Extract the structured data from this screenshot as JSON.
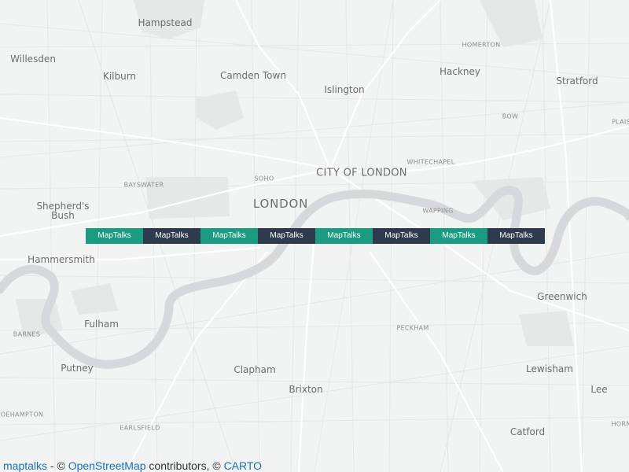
{
  "map": {
    "colors": {
      "background": "#f2f3f3",
      "water": "#d5d8db",
      "park": "#e3e7e5",
      "road_major": "#ffffff",
      "road_minor": "#e6e8e9",
      "label": "#6a6a6a"
    },
    "places": [
      {
        "text": "Hampstead",
        "size": "district"
      },
      {
        "text": "Willesden",
        "size": "district"
      },
      {
        "text": "Kilburn",
        "size": "district"
      },
      {
        "text": "Camden Town",
        "size": "district"
      },
      {
        "text": "Islington",
        "size": "district"
      },
      {
        "text": "HOMERTON",
        "size": "small"
      },
      {
        "text": "Hackney",
        "size": "district"
      },
      {
        "text": "Stratford",
        "size": "district"
      },
      {
        "text": "BOW",
        "size": "small"
      },
      {
        "text": "PLAIS",
        "size": "small"
      },
      {
        "text": "WHITECHAPEL",
        "size": "small"
      },
      {
        "text": "CITY OF LONDON",
        "size": "big"
      },
      {
        "text": "SOHO",
        "size": "small"
      },
      {
        "text": "BAYSWATER",
        "size": "small"
      },
      {
        "text": "Shepherd's Bush",
        "size": "district"
      },
      {
        "text": "LONDON",
        "size": "major"
      },
      {
        "text": "WAPPING",
        "size": "small"
      },
      {
        "text": "Hammersmith",
        "size": "district"
      },
      {
        "text": "Greenwich",
        "size": "district"
      },
      {
        "text": "Fulham",
        "size": "district"
      },
      {
        "text": "PECKHAM",
        "size": "small"
      },
      {
        "text": "BARNES",
        "size": "small"
      },
      {
        "text": "Putney",
        "size": "district"
      },
      {
        "text": "Clapham",
        "size": "district"
      },
      {
        "text": "Lewisham",
        "size": "district"
      },
      {
        "text": "Brixton",
        "size": "district"
      },
      {
        "text": "Lee",
        "size": "district"
      },
      {
        "text": "OEHAMPTON",
        "size": "small"
      },
      {
        "text": "HORN",
        "size": "small"
      },
      {
        "text": "EARLSFIELD",
        "size": "small"
      },
      {
        "text": "Catford",
        "size": "district"
      }
    ]
  },
  "toolbar": {
    "buttons": [
      {
        "label": "MapTalks",
        "style": "green",
        "color": "#1b9b82"
      },
      {
        "label": "MapTalks",
        "style": "dark",
        "color": "#2d3b4c"
      },
      {
        "label": "MapTalks",
        "style": "green",
        "color": "#1b9b82"
      },
      {
        "label": "MapTalks",
        "style": "dark",
        "color": "#2d3b4c"
      },
      {
        "label": "MapTalks",
        "style": "green",
        "color": "#1b9b82"
      },
      {
        "label": "MapTalks",
        "style": "dark",
        "color": "#2d3b4c"
      },
      {
        "label": "MapTalks",
        "style": "green",
        "color": "#1b9b82"
      },
      {
        "label": "MapTalks",
        "style": "dark",
        "color": "#2d3b4c"
      }
    ]
  },
  "attribution": {
    "maptalks": "maptalks",
    "sep1": " - © ",
    "osm": "OpenStreetMap",
    "mid": " contributors, © ",
    "carto": "CARTO"
  }
}
